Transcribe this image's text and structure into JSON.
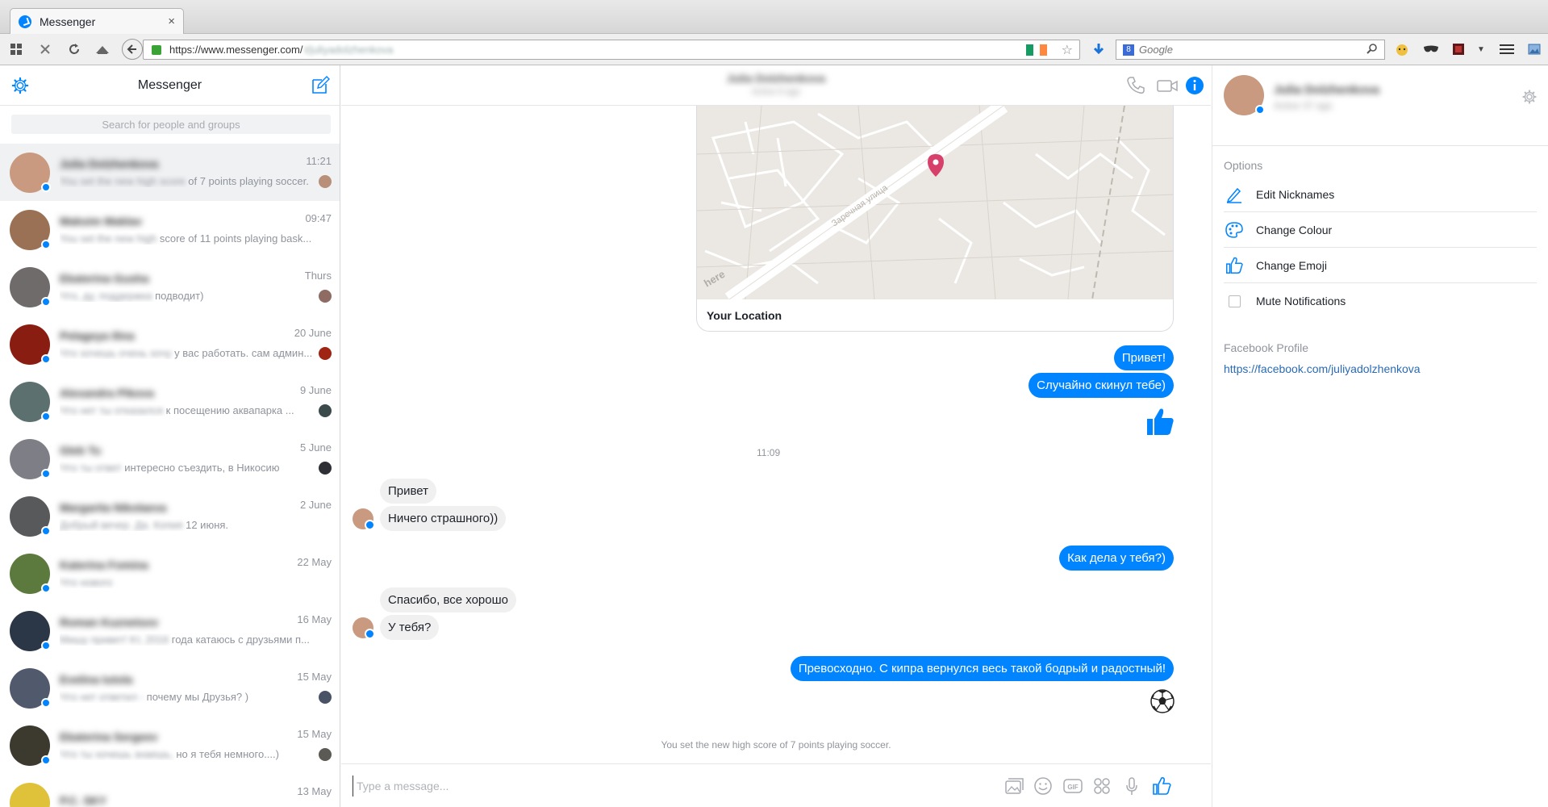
{
  "browser": {
    "tab_title": "Messenger",
    "tab_close": "×",
    "url_host": "https://www.messenger.com/",
    "url_path": "t/juliyadolzhenkova",
    "search_placeholder": "Google",
    "search_logo": "8"
  },
  "sidebar": {
    "title": "Messenger",
    "search_placeholder": "Search for people and groups",
    "conversations": [
      {
        "name": "Julia Dolzhenkova",
        "snippet_blur": "You set the new high score",
        "snippet": " of 7 points playing soccer.",
        "time": "11:21",
        "avatar_color": "#c99a7f",
        "mini": true,
        "mini_color": "#b88f78",
        "active": true
      },
      {
        "name": "Maksim Maklav",
        "snippet_blur": "You set the new high",
        "snippet": " score of 11 points playing bask...",
        "time": "09:47",
        "avatar_color": "#9a7154",
        "mini": false,
        "mini_color": "",
        "active": false
      },
      {
        "name": "Ekaterina Gusha",
        "snippet_blur": "Что, ду, поддержка",
        "snippet": " подводит)",
        "time": "Thurs",
        "avatar_color": "#6f6b6b",
        "mini": true,
        "mini_color": "#8e6b63",
        "active": false
      },
      {
        "name": "Pelageya Ilina",
        "snippet_blur": "Что хочешь очень хочу",
        "snippet": " у вас работать. сам админ...",
        "time": "20 June",
        "avatar_color": "#8a1d12",
        "mini": true,
        "mini_color": "#a02414",
        "active": false
      },
      {
        "name": "Alexandra Pikova",
        "snippet_blur": "Что нет ты отказался",
        "snippet": " к посещению аквапарка ...",
        "time": "9 June",
        "avatar_color": "#5c7070",
        "mini": true,
        "mini_color": "#3b4a4a",
        "active": false
      },
      {
        "name": "Gleb Tu",
        "snippet_blur": "Что ты ответ",
        "snippet": " интересно съездить, в Никосию",
        "time": "5 June",
        "avatar_color": "#7e7f86",
        "mini": true,
        "mini_color": "#2f2f36",
        "active": false
      },
      {
        "name": "Margarita Nikolaeva",
        "snippet_blur": "Добрый вечер. Да. Копия",
        "snippet": " 12 июня.",
        "time": "2 June",
        "avatar_color": "#58595b",
        "mini": false,
        "mini_color": "",
        "active": false
      },
      {
        "name": "Katerina Fomina",
        "snippet_blur": "Что нового",
        "snippet": "",
        "time": "22 May",
        "avatar_color": "#5d7a3e",
        "mini": false,
        "mini_color": "",
        "active": false
      },
      {
        "name": "Roman Kuznetsov",
        "snippet_blur": "Мишу привет! Кт, 2016",
        "snippet": " года катаюсь с друзьями п...",
        "time": "16 May",
        "avatar_color": "#2b3646",
        "mini": false,
        "mini_color": "",
        "active": false
      },
      {
        "name": "Evelina Iutola",
        "snippet_blur": "Что нет ответил -",
        "snippet": " почему мы Друзья? )",
        "time": "15 May",
        "avatar_color": "#515a6c",
        "mini": true,
        "mini_color": "#4a5366",
        "active": false
      },
      {
        "name": "Ekaterina Sergeev",
        "snippet_blur": "Что ты хочешь знаешь,",
        "snippet": " но я тебя немного....)",
        "time": "15 May",
        "avatar_color": "#3c3a2f",
        "mini": true,
        "mini_color": "#5b5a54",
        "active": false
      },
      {
        "name": "P.C. SKY",
        "snippet_blur": "",
        "snippet": "",
        "time": "13 May",
        "avatar_color": "#e0c23a",
        "mini": false,
        "mini_color": "",
        "active": false
      }
    ]
  },
  "chat": {
    "header_name": "Julia Dolzhenkova",
    "header_status": "Active 8 ago",
    "map_title": "Your Location",
    "map_watermark": "here",
    "map_street": "Заречная улица",
    "messages_out_1": "Привет!",
    "messages_out_2": "Случайно скинул тебе)",
    "timestamp": "11:09",
    "messages_in_1": "Привет",
    "messages_in_2": "Ничего страшного))",
    "messages_out_3": "Как дела у тебя?)",
    "messages_in_3": "Спасибо, все хорошо",
    "messages_in_4": "У тебя?",
    "messages_out_4": "Превосходно. С кипра вернулся весь такой бодрый и радостный!",
    "system_message": "You set the new high score of 7 points playing soccer.",
    "composer_placeholder": "Type a message..."
  },
  "info": {
    "name": "Julia Dolzhenkova",
    "status": "Active 37 ago",
    "options_label": "Options",
    "options": [
      "Edit Nicknames",
      "Change Colour",
      "Change Emoji",
      "Mute Notifications"
    ],
    "profile_label": "Facebook Profile",
    "profile_link": "https://facebook.com/juliyadolzhenkova"
  },
  "colors": {
    "accent": "#0084ff",
    "incoming_bubble": "#f1f0f0"
  }
}
